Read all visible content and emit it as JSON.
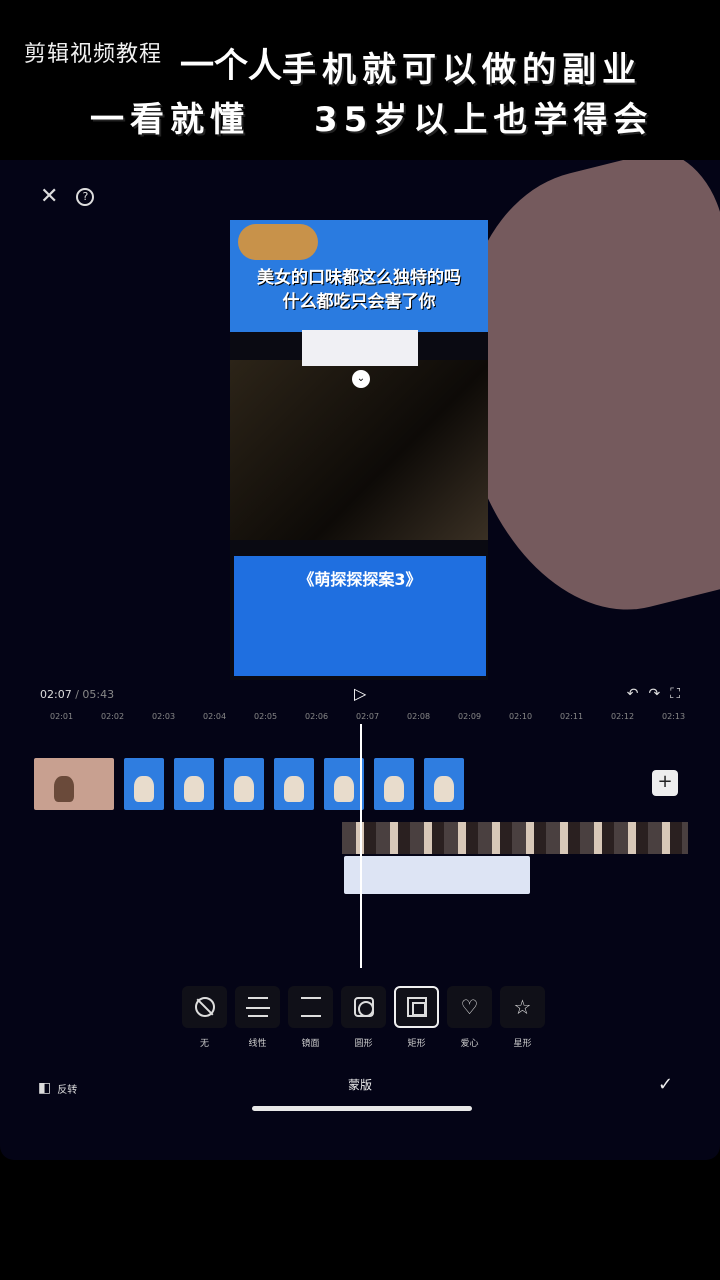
{
  "overlay": {
    "watermark": "剪辑视频教程",
    "headline_prefix": "一个人",
    "headline_line1": "手机就可以做的副业",
    "headline_line2a": "一看就懂",
    "headline_line2b": "35岁以上也学得会"
  },
  "editor": {
    "preview": {
      "caption_line1": "美女的口味都这么独特的吗",
      "caption_line2": "什么都吃只会害了你",
      "bottom_title": "《萌探探探案3》"
    },
    "time": {
      "current": "02:07",
      "separator": " / ",
      "total": "05:43"
    },
    "ruler_ticks": [
      "02:01",
      "02:02",
      "02:03",
      "02:04",
      "02:05",
      "02:06",
      "02:07",
      "02:08",
      "02:09",
      "02:10",
      "02:11",
      "02:12",
      "02:13"
    ],
    "mask_tools": [
      {
        "label": "无",
        "icon": "none-icon"
      },
      {
        "label": "线性",
        "icon": "linear-icon"
      },
      {
        "label": "镜面",
        "icon": "mirror-icon"
      },
      {
        "label": "圆形",
        "icon": "circle-icon"
      },
      {
        "label": "矩形",
        "icon": "rect-icon"
      },
      {
        "label": "爱心",
        "icon": "heart-icon"
      },
      {
        "label": "星形",
        "icon": "star-icon"
      }
    ],
    "bottom_bar": {
      "invert_label": "反转",
      "title": "蒙版"
    }
  }
}
